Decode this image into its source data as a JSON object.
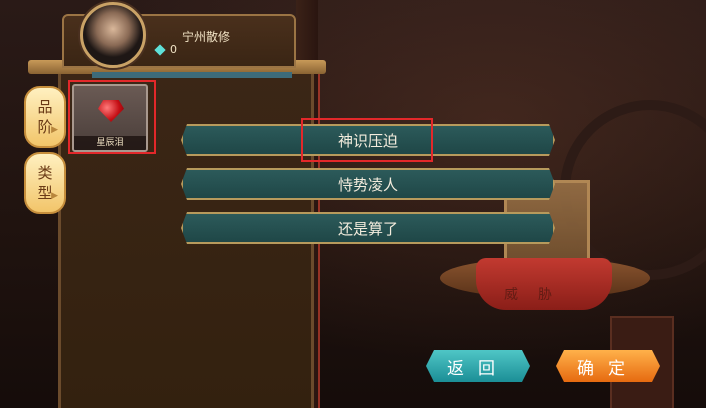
{
  "player": {
    "name": "宁州散修",
    "gem_count": "0",
    "avatar_icon": "character-portrait"
  },
  "sidebar_tabs": [
    {
      "label_1": "品",
      "label_2": "阶"
    },
    {
      "label_1": "类",
      "label_2": "型"
    }
  ],
  "inventory": {
    "items": [
      {
        "name": "星辰泪",
        "icon": "red-gem-icon"
      }
    ]
  },
  "dialog_options": [
    {
      "label": "神识压迫"
    },
    {
      "label": "恃势凌人"
    },
    {
      "label": "还是算了"
    }
  ],
  "table_cloth_text": "威胁",
  "buttons": {
    "back": "返回",
    "confirm": "确定"
  },
  "colors": {
    "highlight": "#e3282a",
    "back_button": "#2aa8ae",
    "confirm_button": "#f08a24",
    "option_fill": "#245050"
  }
}
